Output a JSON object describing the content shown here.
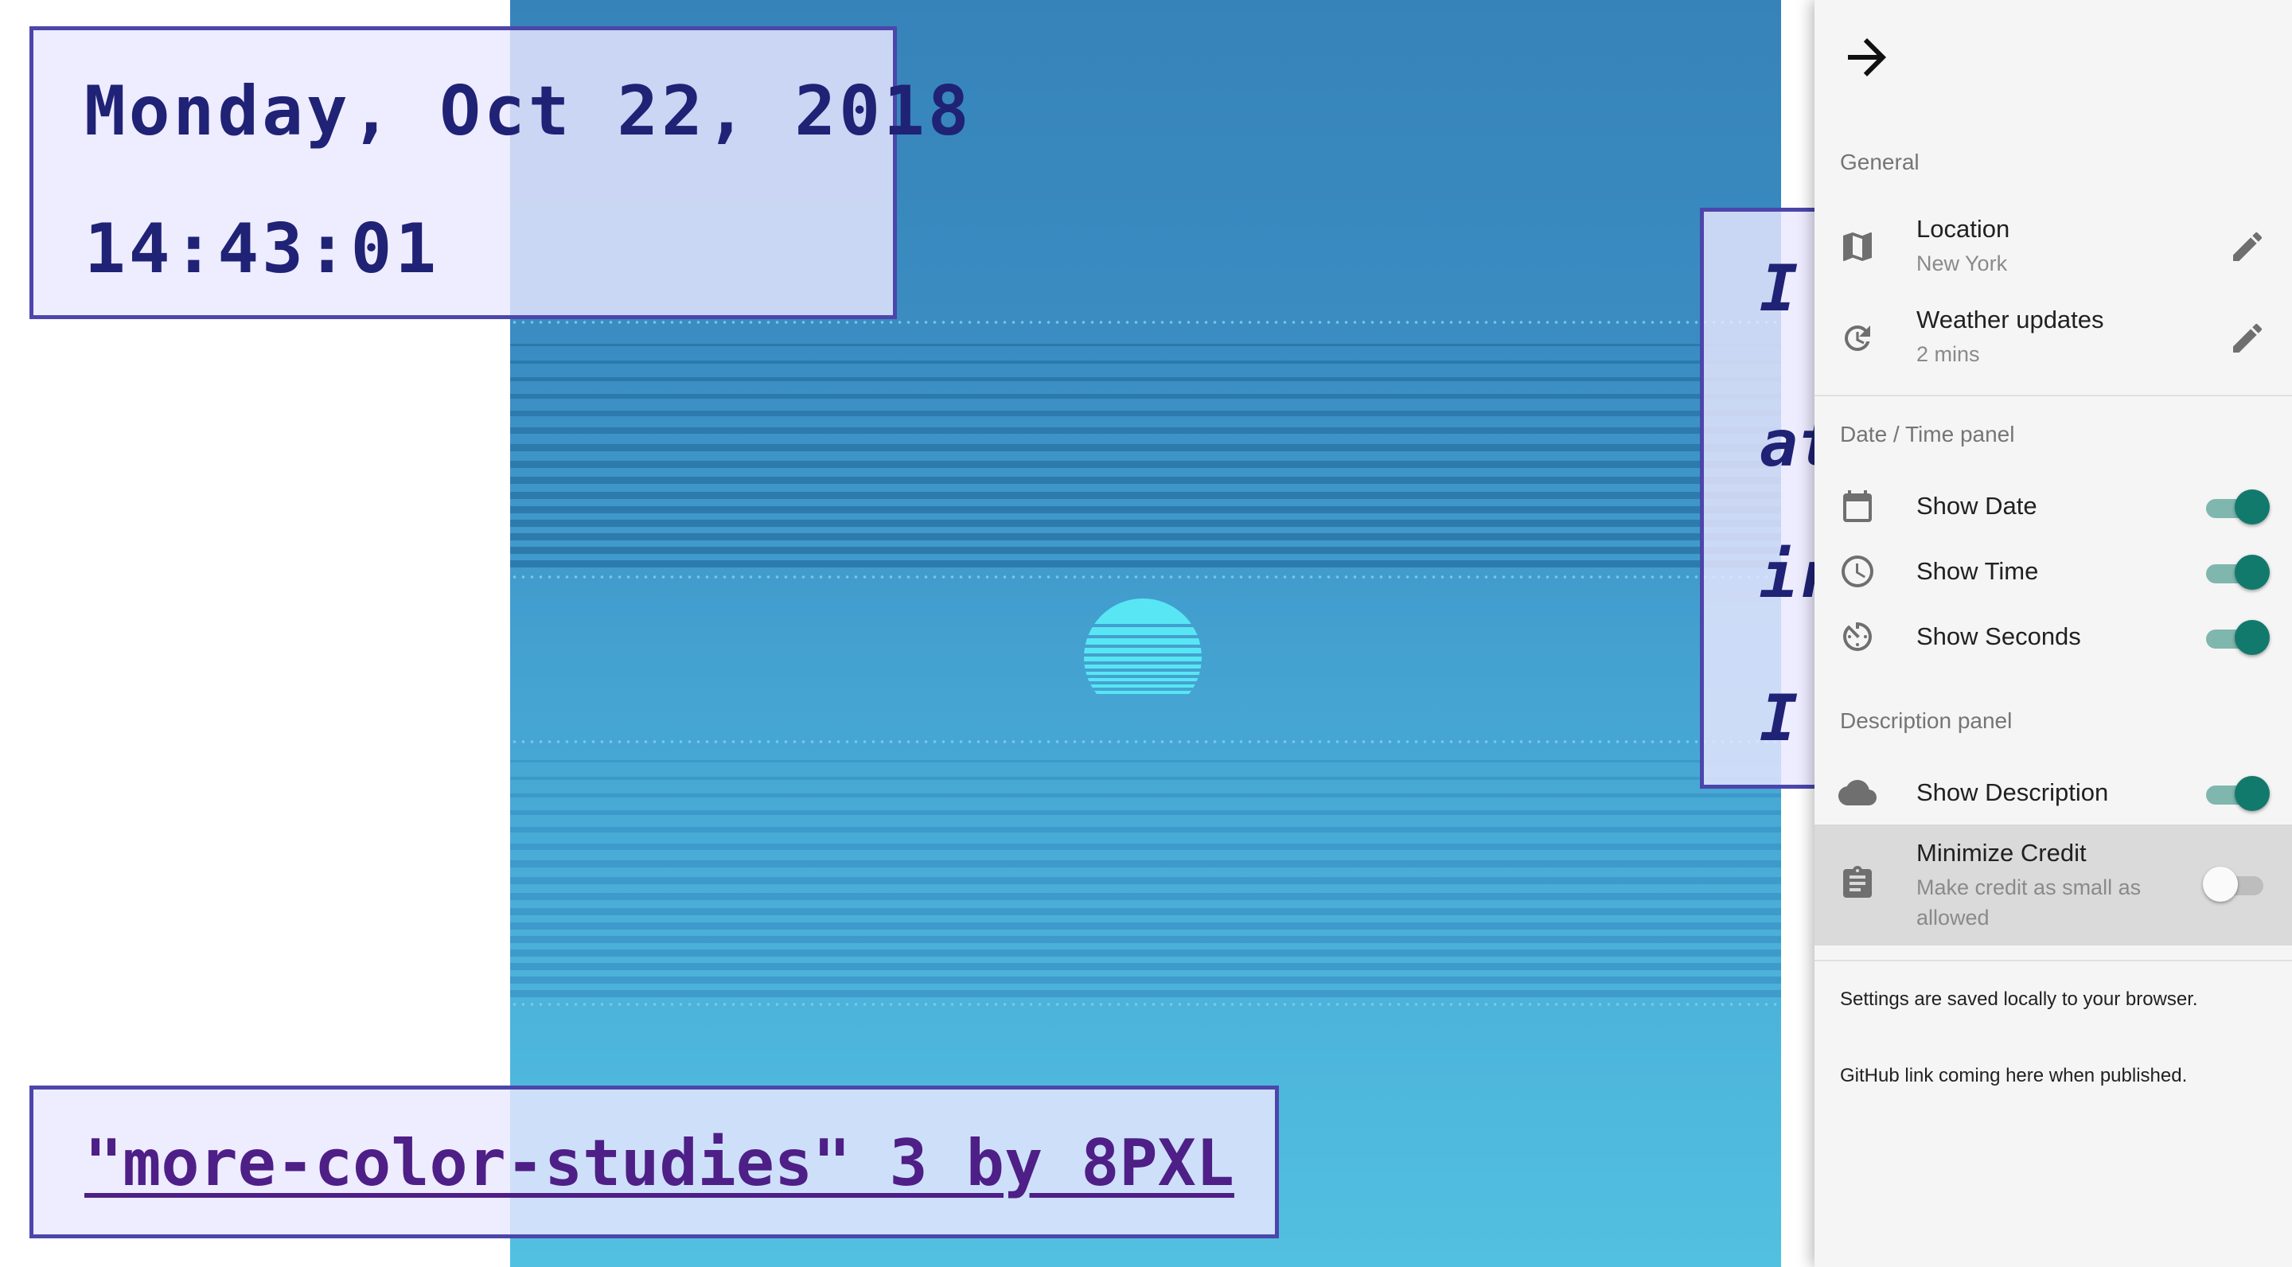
{
  "datetime": {
    "date": "Monday, Oct 22, 2018",
    "time": "14:43:01"
  },
  "description": {
    "lines": [
      "I",
      "at",
      "ir",
      "I"
    ]
  },
  "credit": {
    "text": "\"more-color-studies\" 3 by 8PXL"
  },
  "settings": {
    "close_icon": "arrow-forward-icon",
    "general": {
      "title": "General",
      "location": {
        "title": "Location",
        "value": "New York",
        "icon": "map-icon"
      },
      "weather": {
        "title": "Weather updates",
        "value": "2 mins",
        "icon": "refresh-icon"
      }
    },
    "datetime_panel": {
      "title": "Date / Time panel",
      "show_date": {
        "label": "Show Date",
        "on": true,
        "icon": "calendar-icon"
      },
      "show_time": {
        "label": "Show Time",
        "on": true,
        "icon": "clock-icon"
      },
      "show_seconds": {
        "label": "Show Seconds",
        "on": true,
        "icon": "timer-icon"
      }
    },
    "description_panel": {
      "title": "Description panel",
      "show_description": {
        "label": "Show Description",
        "on": true,
        "icon": "cloud-icon"
      },
      "minimize_credit": {
        "label": "Minimize Credit",
        "sub_1": "Make credit as small as",
        "sub_2": "allowed",
        "on": false,
        "icon": "clipboard-icon"
      }
    },
    "footer": {
      "saved_note": "Settings are saved locally to your browser.",
      "github_note": "GitHub link coming here when published."
    }
  },
  "colors": {
    "accent": "#127a6d",
    "card_border": "#4c46ab",
    "card_text": "#1f2275",
    "link": "#4e1f86"
  }
}
